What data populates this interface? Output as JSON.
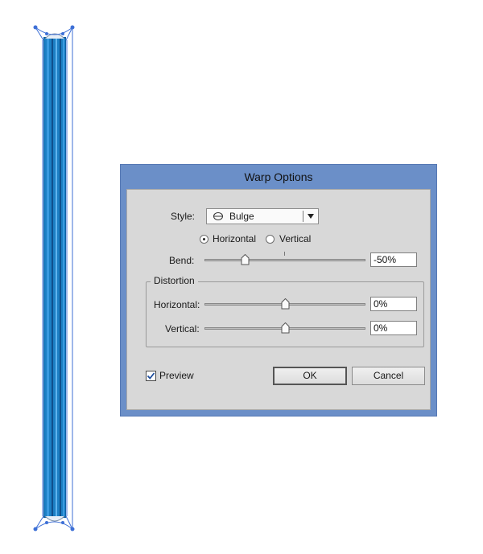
{
  "dialog": {
    "title": "Warp Options",
    "style_label": "Style:",
    "style_value": "Bulge",
    "style_icon": "bulge-icon",
    "orientation": {
      "horizontal_label": "Horizontal",
      "vertical_label": "Vertical",
      "selected": "horizontal"
    },
    "bend": {
      "label": "Bend:",
      "value": "-50%",
      "level": -0.5
    },
    "distortion": {
      "title": "Distortion",
      "horizontal": {
        "label": "Horizontal:",
        "value": "0%",
        "level": 0
      },
      "vertical": {
        "label": "Vertical:",
        "value": "0%",
        "level": 0
      }
    },
    "preview": {
      "label": "Preview",
      "checked": true
    },
    "ok_label": "OK",
    "cancel_label": "Cancel"
  },
  "colors": {
    "dialog_frame": "#6b8fc8",
    "artwork_fill": "#1c7fc4",
    "selection": "#3d6fd6"
  }
}
